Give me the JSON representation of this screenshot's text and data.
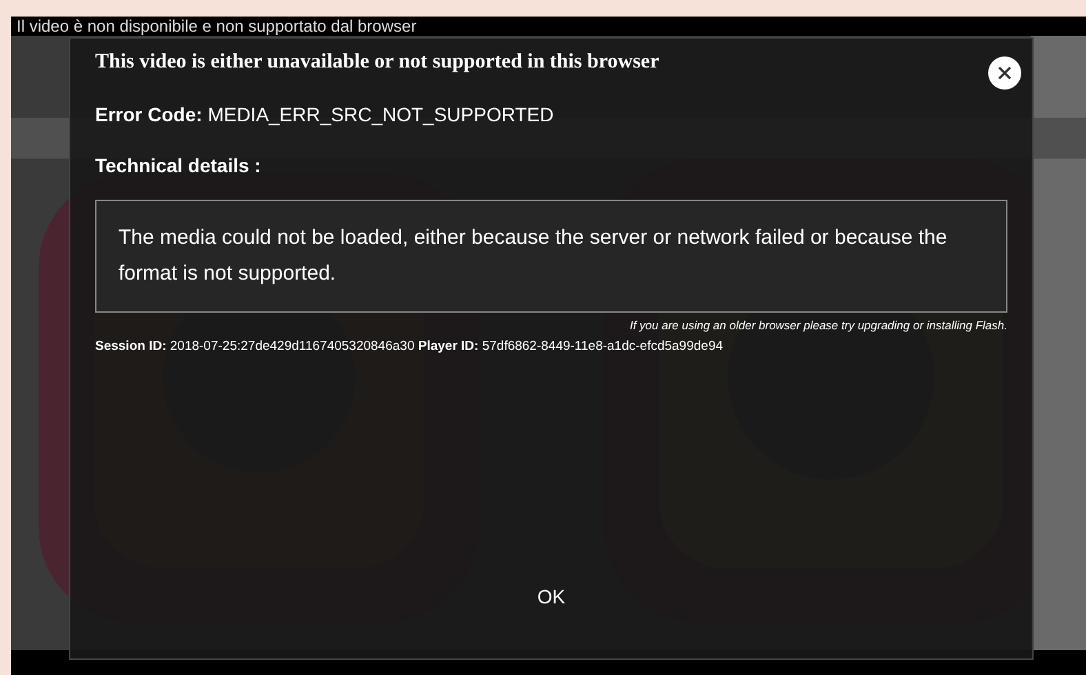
{
  "player_caption": "Il video è non disponibile e non supportato dal browser",
  "dialog": {
    "title": "This video is either unavailable or not supported in this browser",
    "error_label": "Error Code:",
    "error_code": "MEDIA_ERR_SRC_NOT_SUPPORTED",
    "details_heading": "Technical details :",
    "details_message": "The media could not be loaded, either because the server or network failed or because the format is not supported.",
    "browser_note": "If you are using an older browser please try upgrading or installing Flash.",
    "session_label": "Session ID:",
    "session_id": "2018-07-25:27de429d1167405320846a30",
    "player_label": "Player ID:",
    "player_id": "57df6862-8449-11e8-a1dc-efcd5a99de94",
    "ok_button": "OK"
  }
}
